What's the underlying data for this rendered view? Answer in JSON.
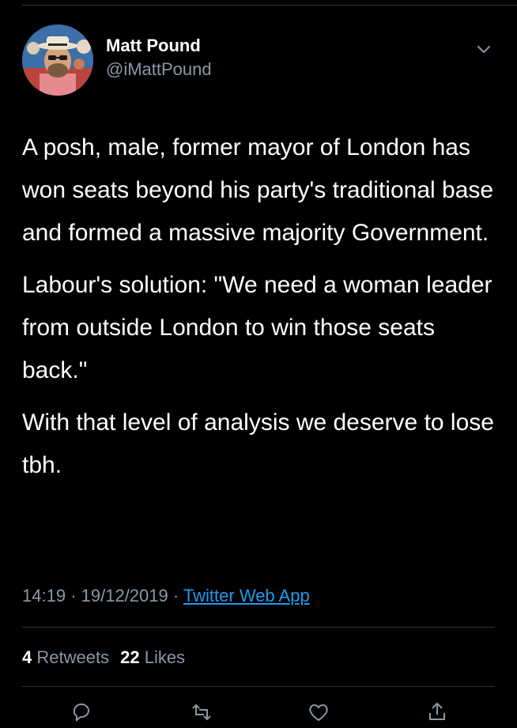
{
  "colors": {
    "background": "#000000",
    "text": "#ffffff",
    "secondary": "#8b98a5",
    "link": "#1d9bf0",
    "divider": "#2f3336"
  },
  "author": {
    "display_name": "Matt Pound",
    "handle": "@iMattPound",
    "avatar": "profile-photo"
  },
  "tweet": {
    "paragraphs": [
      "A posh, male, former mayor of London has won seats beyond his party's traditional base and formed a massive majority Government.",
      "Labour's solution: \"We need a woman leader from outside London to win those seats back.\"",
      "With that level of analysis we deserve to lose tbh."
    ],
    "time": "14:19",
    "date": "19/12/2019",
    "separator": "·",
    "source": "Twitter Web App"
  },
  "stats": {
    "retweets_count": "4",
    "retweets_label": "Retweets",
    "likes_count": "22",
    "likes_label": "Likes"
  },
  "icons": {
    "more": "chevron-down-icon",
    "reply": "reply-icon",
    "retweet": "retweet-icon",
    "like": "heart-icon",
    "share": "share-icon"
  }
}
